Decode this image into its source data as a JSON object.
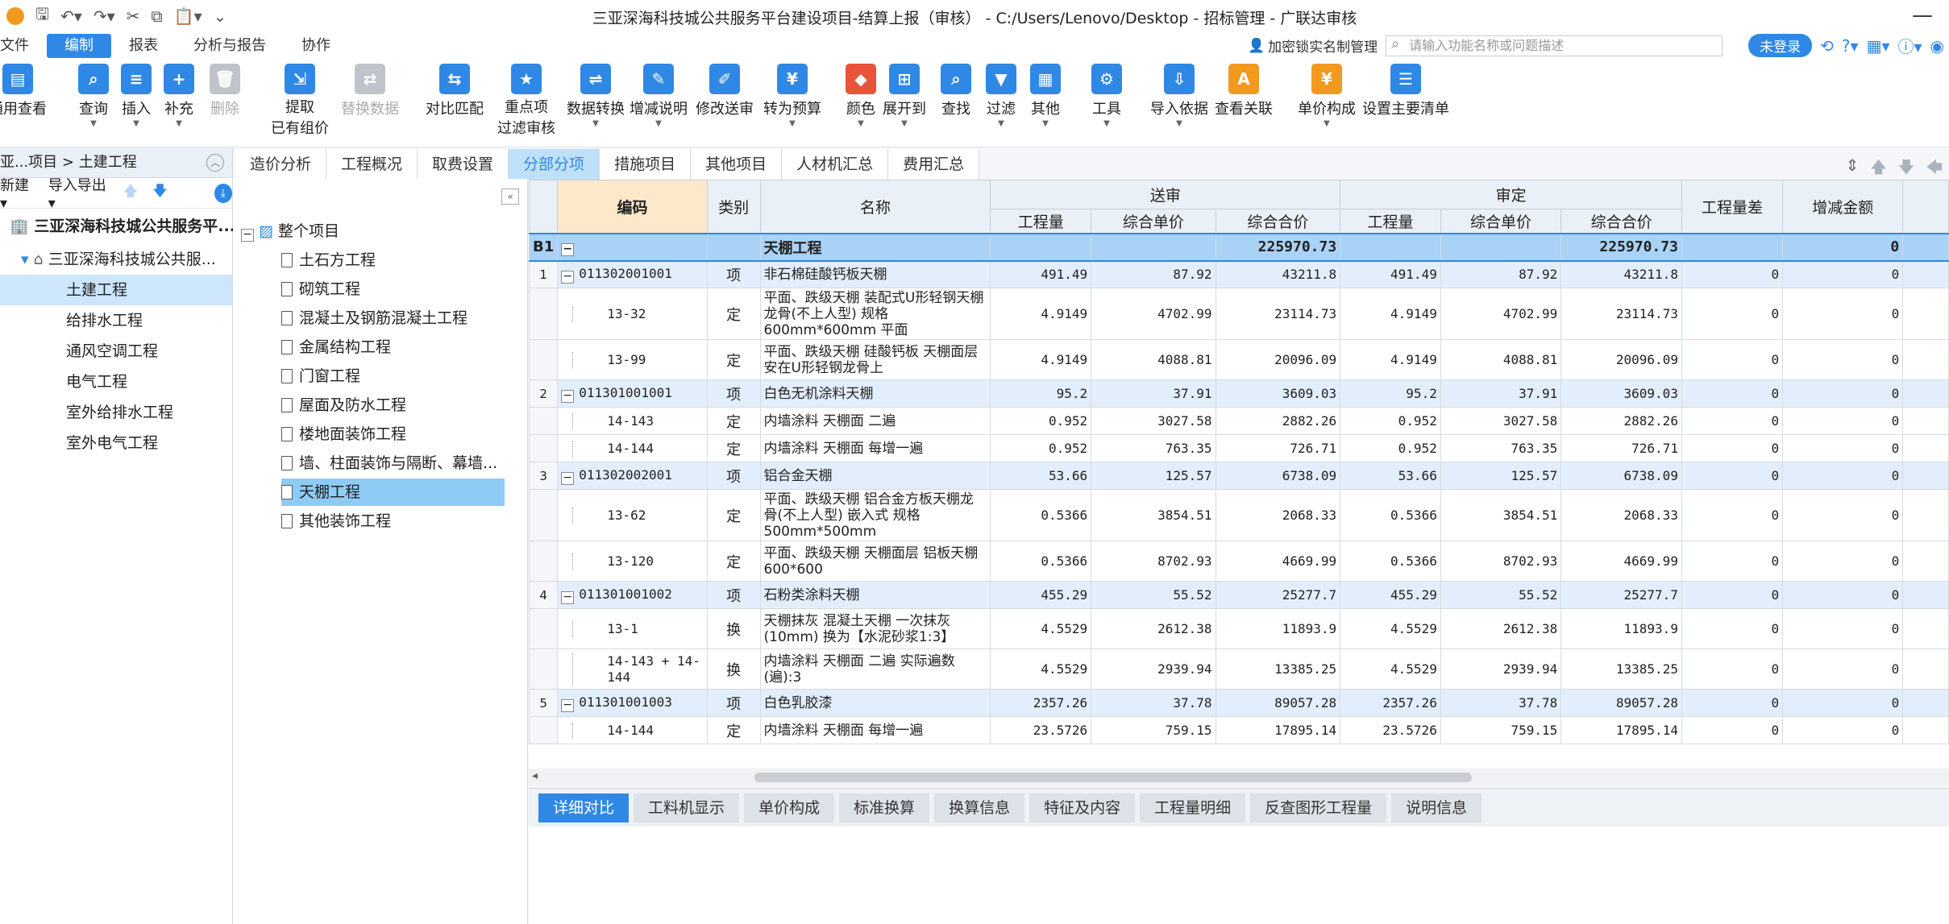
{
  "window": {
    "title": "三亚深海科技城公共服务平台建设项目-结算上报（审核） - C:/Users/Lenovo/Desktop - 招标管理 - 广联达审核"
  },
  "menu": {
    "items": [
      "文件",
      "编制",
      "报表",
      "分析与报告",
      "协作"
    ],
    "realname": "加密锁实名制管理",
    "search_placeholder": "请输入功能名称或问题描述",
    "login": "未登录"
  },
  "ribbon": {
    "buttons": [
      "通用查看",
      "查询",
      "插入",
      "补充",
      "删除",
      "提取\n已有组价",
      "替换数据",
      "对比匹配",
      "重点项\n过滤审核",
      "数据转换",
      "增减说明",
      "修改送审",
      "转为预算",
      "颜色",
      "展开到",
      "查找",
      "过滤",
      "其他",
      "工具",
      "导入依据",
      "查看关联",
      "单价构成",
      "设置主要清单"
    ]
  },
  "left": {
    "breadcrumb": "亚...项目 > 土建工程",
    "new": "新建",
    "import_export": "导入导出",
    "project": "三亚深海科技城公共服务平...",
    "sub": "三亚深海科技城公共服...",
    "units": [
      "土建工程",
      "给排水工程",
      "通风空调工程",
      "电气工程",
      "室外给排水工程",
      "室外电气工程"
    ]
  },
  "mid": {
    "root": "整个项目",
    "nodes": [
      "土石方工程",
      "砌筑工程",
      "混凝土及钢筋混凝土工程",
      "金属结构工程",
      "门窗工程",
      "屋面及防水工程",
      "楼地面装饰工程",
      "墙、柱面装饰与隔断、幕墙...",
      "天棚工程",
      "其他装饰工程"
    ]
  },
  "tabs": [
    "造价分析",
    "工程概况",
    "取费设置",
    "分部分项",
    "措施项目",
    "其他项目",
    "人材机汇总",
    "费用汇总"
  ],
  "grid": {
    "headers": {
      "code": "编码",
      "cat": "类别",
      "name": "名称",
      "sent": "送审",
      "audit": "审定",
      "qty": "工程量",
      "price": "综合单价",
      "total": "综合合价",
      "diff": "工程量差",
      "change": "增减金额"
    },
    "section": {
      "rn": "B1",
      "name": "天棚工程",
      "sent_total": "225970.73",
      "audit_total": "225970.73",
      "change": "0"
    },
    "rows": [
      {
        "rn": "1",
        "code": "011302001001",
        "cat": "项",
        "name": "非石棉硅酸钙板天棚",
        "q": "491.49",
        "p": "87.92",
        "t": "43211.8",
        "aq": "491.49",
        "ap": "87.92",
        "at": "43211.8",
        "d": "0",
        "c": "0",
        "type": "qd"
      },
      {
        "rn": "",
        "code": "13-32",
        "cat": "定",
        "name": "平面、跌级天棚 装配式U形轻钢天棚龙骨(不上人型) 规格600mm*600mm 平面",
        "q": "4.9149",
        "p": "4702.99",
        "t": "23114.73",
        "aq": "4.9149",
        "ap": "4702.99",
        "at": "23114.73",
        "d": "0",
        "c": "0",
        "type": "de",
        "h": 3
      },
      {
        "rn": "",
        "code": "13-99",
        "cat": "定",
        "name": "平面、跌级天棚 硅酸钙板 天棚面层 安在U形轻钢龙骨上",
        "q": "4.9149",
        "p": "4088.81",
        "t": "20096.09",
        "aq": "4.9149",
        "ap": "4088.81",
        "at": "20096.09",
        "d": "0",
        "c": "0",
        "type": "de",
        "h": 2
      },
      {
        "rn": "2",
        "code": "011301001001",
        "cat": "项",
        "name": "白色无机涂料天棚",
        "q": "95.2",
        "p": "37.91",
        "t": "3609.03",
        "aq": "95.2",
        "ap": "37.91",
        "at": "3609.03",
        "d": "0",
        "c": "0",
        "type": "qd"
      },
      {
        "rn": "",
        "code": "14-143",
        "cat": "定",
        "name": "内墙涂料 天棚面 二遍",
        "q": "0.952",
        "p": "3027.58",
        "t": "2882.26",
        "aq": "0.952",
        "ap": "3027.58",
        "at": "2882.26",
        "d": "0",
        "c": "0",
        "type": "de"
      },
      {
        "rn": "",
        "code": "14-144",
        "cat": "定",
        "name": "内墙涂料 天棚面 每增一遍",
        "q": "0.952",
        "p": "763.35",
        "t": "726.71",
        "aq": "0.952",
        "ap": "763.35",
        "at": "726.71",
        "d": "0",
        "c": "0",
        "type": "de"
      },
      {
        "rn": "3",
        "code": "011302002001",
        "cat": "项",
        "name": "铝合金天棚",
        "q": "53.66",
        "p": "125.57",
        "t": "6738.09",
        "aq": "53.66",
        "ap": "125.57",
        "at": "6738.09",
        "d": "0",
        "c": "0",
        "type": "qd"
      },
      {
        "rn": "",
        "code": "13-62",
        "cat": "定",
        "name": "平面、跌级天棚 铝合金方板天棚龙骨(不上人型) 嵌入式 规格500mm*500mm",
        "q": "0.5366",
        "p": "3854.51",
        "t": "2068.33",
        "aq": "0.5366",
        "ap": "3854.51",
        "at": "2068.33",
        "d": "0",
        "c": "0",
        "type": "de",
        "h": 3
      },
      {
        "rn": "",
        "code": "13-120",
        "cat": "定",
        "name": "平面、跌级天棚 天棚面层 铝板天棚 600*600",
        "q": "0.5366",
        "p": "8702.93",
        "t": "4669.99",
        "aq": "0.5366",
        "ap": "8702.93",
        "at": "4669.99",
        "d": "0",
        "c": "0",
        "type": "de",
        "h": 2
      },
      {
        "rn": "4",
        "code": "011301001002",
        "cat": "项",
        "name": "石粉类涂料天棚",
        "q": "455.29",
        "p": "55.52",
        "t": "25277.7",
        "aq": "455.29",
        "ap": "55.52",
        "at": "25277.7",
        "d": "0",
        "c": "0",
        "type": "qd"
      },
      {
        "rn": "",
        "code": "13-1",
        "cat": "换",
        "name": "天棚抹灰 混凝土天棚 一次抹灰(10mm) 换为【水泥砂浆1:3】",
        "q": "4.5529",
        "p": "2612.38",
        "t": "11893.9",
        "aq": "4.5529",
        "ap": "2612.38",
        "at": "11893.9",
        "d": "0",
        "c": "0",
        "type": "de",
        "h": 2
      },
      {
        "rn": "",
        "code": "14-143 + 14-144",
        "cat": "换",
        "name": "内墙涂料 天棚面 二遍 实际遍数(遍):3",
        "q": "4.5529",
        "p": "2939.94",
        "t": "13385.25",
        "aq": "4.5529",
        "ap": "2939.94",
        "at": "13385.25",
        "d": "0",
        "c": "0",
        "type": "de",
        "h": 2
      },
      {
        "rn": "5",
        "code": "011301001003",
        "cat": "项",
        "name": "白色乳胶漆",
        "q": "2357.26",
        "p": "37.78",
        "t": "89057.28",
        "aq": "2357.26",
        "ap": "37.78",
        "at": "89057.28",
        "d": "0",
        "c": "0",
        "type": "qd"
      },
      {
        "rn": "",
        "code": "14-144",
        "cat": "定",
        "name": "内墙涂料 天棚面 每增一遍",
        "q": "23.5726",
        "p": "759.15",
        "t": "17895.14",
        "aq": "23.5726",
        "ap": "759.15",
        "at": "17895.14",
        "d": "0",
        "c": "0",
        "type": "de"
      }
    ]
  },
  "bottom_tabs": [
    "详细对比",
    "工料机显示",
    "单价构成",
    "标准换算",
    "换算信息",
    "特征及内容",
    "工程量明细",
    "反查图形工程量",
    "说明信息"
  ]
}
